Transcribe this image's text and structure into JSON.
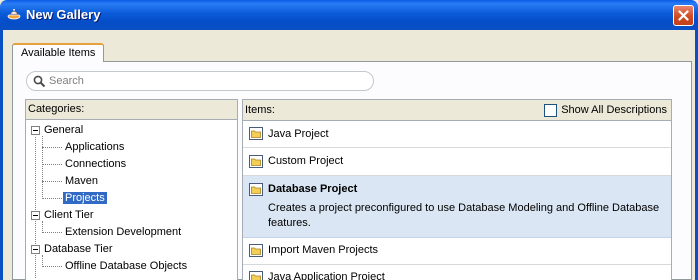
{
  "window": {
    "title": "New Gallery"
  },
  "tab": {
    "label": "Available Items"
  },
  "search": {
    "placeholder": "Search"
  },
  "categories": {
    "header": "Categories:",
    "tree": {
      "general": {
        "label": "General",
        "children": [
          "Applications",
          "Connections",
          "Maven",
          "Projects"
        ],
        "selected": "Projects"
      },
      "client_tier": {
        "label": "Client Tier",
        "children": [
          "Extension Development"
        ]
      },
      "database_tier": {
        "label": "Database Tier",
        "children": [
          "Offline Database Objects"
        ]
      }
    }
  },
  "items": {
    "header": "Items:",
    "show_all_label": "Show All Descriptions",
    "show_all_checked": false,
    "list": [
      {
        "label": "Java Project"
      },
      {
        "label": "Custom Project"
      },
      {
        "label": "Database Project",
        "selected": true,
        "description": "Creates a project preconfigured to use Database Modeling and Offline Database features."
      },
      {
        "label": "Import Maven Projects"
      },
      {
        "label": "Java Application Project"
      }
    ]
  },
  "colors": {
    "titlebar": "#0a5ce6",
    "selection": "#316ac5",
    "selected_item_bg": "#dae6f3",
    "tab_accent": "#e6a03b"
  },
  "icons": {
    "app": "gallery-app-icon",
    "close": "close-icon",
    "search": "search-icon",
    "item": "folder-icon"
  }
}
